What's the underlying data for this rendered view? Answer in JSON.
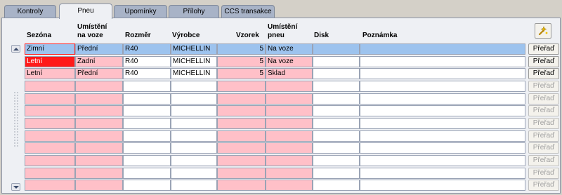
{
  "tabs": [
    {
      "label": "Kontroly",
      "active": false
    },
    {
      "label": "Pneu",
      "active": true
    },
    {
      "label": "Upomínky",
      "active": false
    },
    {
      "label": "Přílohy",
      "active": false
    },
    {
      "label": "CCS transakce",
      "active": false
    }
  ],
  "columns": {
    "sezona": "Sezóna",
    "umisteni_vozu_1": "Umístění",
    "umisteni_vozu_2": "na voze",
    "rozmer": "Rozměr",
    "vyrobce": "Výrobce",
    "vzorek": "Vzorek",
    "umisteni_pneu_1": "Umístění",
    "umisteni_pneu_2": "pneu",
    "disk": "Disk",
    "poznamka": "Poznámka"
  },
  "toolbar": {
    "action_icon": "edit-wand-icon"
  },
  "rows": [
    {
      "sezona": "Zimní",
      "umisteni": "Přední",
      "rozmer": "R40",
      "vyrobce": "MICHELLIN",
      "vzorek": "5",
      "pneu": "Na voze",
      "disk": "",
      "poznamka": "",
      "button": "Přeřaď",
      "state": "selected"
    },
    {
      "sezona": "Letní",
      "umisteni": "Zadní",
      "rozmer": "R40",
      "vyrobce": "MICHELLIN",
      "vzorek": "5",
      "pneu": "Na voze",
      "disk": "",
      "poznamka": "",
      "button": "Přeřaď",
      "state": "normal"
    },
    {
      "sezona": "Letní",
      "umisteni": "Přední",
      "rozmer": "R40",
      "vyrobce": "MICHELLIN",
      "vzorek": "5",
      "pneu": "Sklad",
      "disk": "",
      "poznamka": "",
      "button": "Přeřaď",
      "state": "normal"
    },
    {
      "sezona": "",
      "umisteni": "",
      "rozmer": "",
      "vyrobce": "",
      "vzorek": "",
      "pneu": "",
      "disk": "",
      "poznamka": "",
      "button": "Přeřaď",
      "state": "empty"
    },
    {
      "sezona": "",
      "umisteni": "",
      "rozmer": "",
      "vyrobce": "",
      "vzorek": "",
      "pneu": "",
      "disk": "",
      "poznamka": "",
      "button": "Přeřaď",
      "state": "empty"
    },
    {
      "sezona": "",
      "umisteni": "",
      "rozmer": "",
      "vyrobce": "",
      "vzorek": "",
      "pneu": "",
      "disk": "",
      "poznamka": "",
      "button": "Přeřaď",
      "state": "empty"
    },
    {
      "sezona": "",
      "umisteni": "",
      "rozmer": "",
      "vyrobce": "",
      "vzorek": "",
      "pneu": "",
      "disk": "",
      "poznamka": "",
      "button": "Přeřaď",
      "state": "empty"
    },
    {
      "sezona": "",
      "umisteni": "",
      "rozmer": "",
      "vyrobce": "",
      "vzorek": "",
      "pneu": "",
      "disk": "",
      "poznamka": "",
      "button": "Přeřaď",
      "state": "empty"
    },
    {
      "sezona": "",
      "umisteni": "",
      "rozmer": "",
      "vyrobce": "",
      "vzorek": "",
      "pneu": "",
      "disk": "",
      "poznamka": "",
      "button": "Přeřaď",
      "state": "empty"
    },
    {
      "sezona": "",
      "umisteni": "",
      "rozmer": "",
      "vyrobce": "",
      "vzorek": "",
      "pneu": "",
      "disk": "",
      "poznamka": "",
      "button": "Přeřaď",
      "state": "empty"
    },
    {
      "sezona": "",
      "umisteni": "",
      "rozmer": "",
      "vyrobce": "",
      "vzorek": "",
      "pneu": "",
      "disk": "",
      "poznamka": "",
      "button": "Přeřaď",
      "state": "empty"
    },
    {
      "sezona": "",
      "umisteni": "",
      "rozmer": "",
      "vyrobce": "",
      "vzorek": "",
      "pneu": "",
      "disk": "",
      "poznamka": "",
      "button": "Přeřaď",
      "state": "empty"
    }
  ],
  "colors": {
    "pink_cell": "#ffc0c8",
    "selected_row": "#9dc3ee",
    "alert_cell": "#ff1a1a",
    "panel_bg": "#eef0f4",
    "tab_bg": "#a8b3c7"
  }
}
